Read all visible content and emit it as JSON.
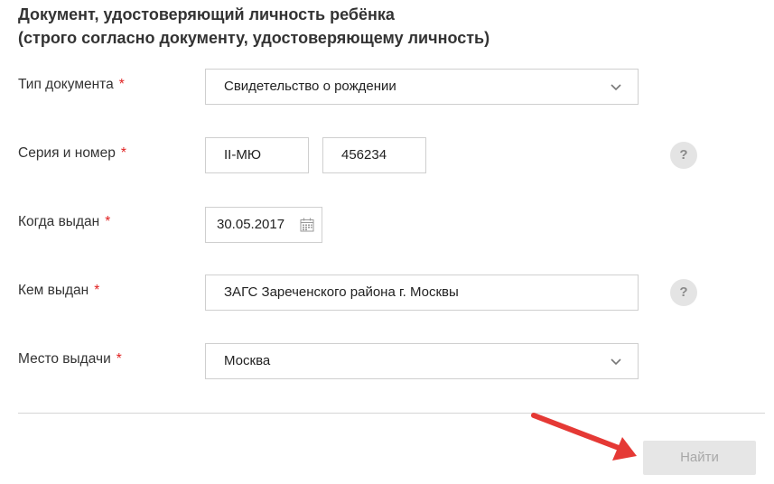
{
  "section": {
    "title_line1": "Документ, удостоверяющий личность ребёнка",
    "title_line2": "(строго согласно документу, удостоверяющему личность)"
  },
  "fields": {
    "doc_type": {
      "label": "Тип документа",
      "value": "Свидетельство о рождении"
    },
    "series_number": {
      "label": "Серия и номер",
      "series": "II-МЮ",
      "number": "456234"
    },
    "issue_date": {
      "label": "Когда выдан",
      "value": "30.05.2017"
    },
    "issued_by": {
      "label": "Кем выдан",
      "value": "ЗАГС Зареченского района г. Москвы"
    },
    "issue_place": {
      "label": "Место выдачи",
      "value": "Москва"
    }
  },
  "required_mark": "*",
  "help_mark": "?",
  "actions": {
    "find_label": "Найти"
  },
  "icons": [
    "chevron-down-icon",
    "calendar-icon",
    "help-icon",
    "arrow-icon"
  ],
  "colors": {
    "required": "#e02020",
    "arrow": "#e53935",
    "button_bg": "#e6e6e6",
    "button_text": "#a8a8a8"
  }
}
